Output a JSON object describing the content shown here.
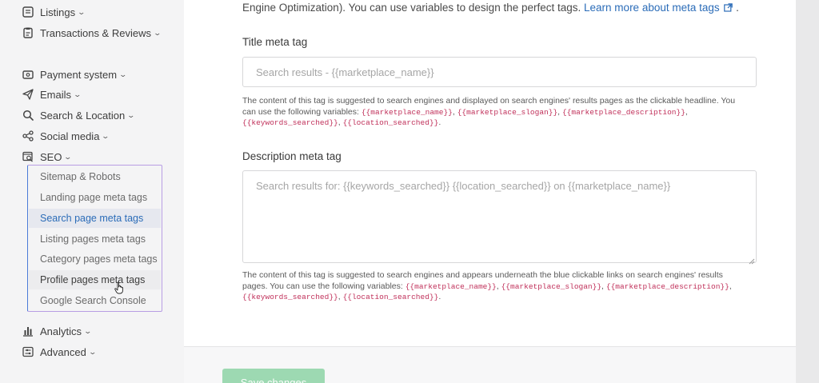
{
  "sidebar": {
    "items": [
      {
        "label": "Listings",
        "icon": "listings-icon"
      },
      {
        "label": "Transactions & Reviews",
        "icon": "transactions-icon"
      },
      {
        "label": "Payment system",
        "icon": "payment-icon"
      },
      {
        "label": "Emails",
        "icon": "paper-plane-icon"
      },
      {
        "label": "Search & Location",
        "icon": "search-icon"
      },
      {
        "label": "Social media",
        "icon": "share-icon"
      },
      {
        "label": "SEO",
        "icon": "seo-icon"
      },
      {
        "label": "Analytics",
        "icon": "bar-chart-icon"
      },
      {
        "label": "Advanced",
        "icon": "advanced-icon"
      }
    ],
    "seo_subitems": [
      {
        "label": "Sitemap & Robots"
      },
      {
        "label": "Landing page meta tags"
      },
      {
        "label": "Search page meta tags"
      },
      {
        "label": "Listing pages meta tags"
      },
      {
        "label": "Category pages meta tags"
      },
      {
        "label": "Profile pages meta tags"
      },
      {
        "label": "Google Search Console"
      }
    ],
    "active_subitem": "Search page meta tags"
  },
  "main": {
    "intro_text": "Engine Optimization). You can use variables to design the perfect tags.",
    "intro_link": "Learn more about meta tags",
    "intro_tail": ".",
    "title_tag": {
      "label": "Title meta tag",
      "placeholder": "Search results - {{marketplace_name}}",
      "help_prefix": "The content of this tag is suggested to search engines and displayed on search engines' results pages as the clickable headline. You can use the following variables:",
      "vars": [
        "{{marketplace_name}}",
        "{{marketplace_slogan}}",
        "{{marketplace_description}}",
        "{{keywords_searched}}",
        "{{location_searched}}"
      ]
    },
    "description_tag": {
      "label": "Description meta tag",
      "placeholder": "Search results for: {{keywords_searched}} {{location_searched}} on {{marketplace_name}}",
      "help_prefix": "The content of this tag is suggested to search engines and appears underneath the blue clickable links on search engines' results pages. You can use the following variables:",
      "vars": [
        "{{marketplace_name}}",
        "{{marketplace_slogan}}",
        "{{marketplace_description}}",
        "{{keywords_searched}}",
        "{{location_searched}}"
      ]
    },
    "save_label": "Save changes"
  },
  "colors": {
    "link": "#2b6cb8",
    "code": "#c0305a",
    "save_button": "#9dd9b2",
    "highlight_border": "#b89ee4"
  }
}
